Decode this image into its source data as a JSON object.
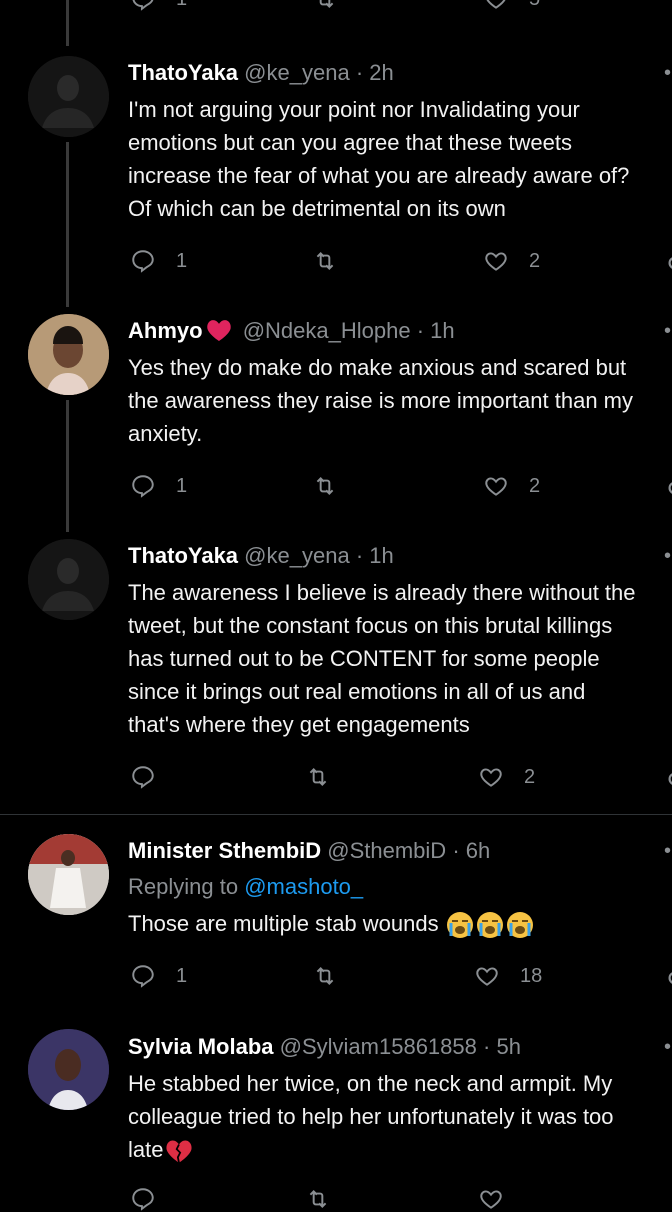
{
  "top_partial": {
    "like_count": "5",
    "reply_count": "1"
  },
  "tweets": [
    {
      "name": "ThatoYaka",
      "handle": "@ke_yena",
      "time": "2h",
      "lines": [
        "I'm not arguing your point nor Invalidating your",
        "emotions but can you agree that these tweets",
        "increase the fear of what you are already aware of?",
        "Of which can be detrimental on its own"
      ],
      "reply_count": "1",
      "like_count": "2"
    },
    {
      "name": "Ahmyo",
      "handle": "@Ndeka_Hlophe",
      "time": "1h",
      "lines": [
        "Yes they do make do make anxious and scared  but",
        "the awareness they raise is more important than my",
        "anxiety."
      ],
      "reply_count": "1",
      "like_count": "2"
    },
    {
      "name": "ThatoYaka",
      "handle": "@ke_yena",
      "time": "1h",
      "lines": [
        "The awareness I believe is already there without the",
        "tweet, but the constant focus on this brutal killings",
        "has turned out to be CONTENT for some people",
        "since it brings out real emotions in all of us and",
        "that's where they get engagements"
      ],
      "reply_count": "",
      "like_count": "2"
    },
    {
      "name": "Minister SthembiD",
      "handle": "@SthembiD",
      "time": "6h",
      "replying_label": "Replying to",
      "replying_to": "@mashoto_",
      "lines": [
        "Those are multiple stab wounds"
      ],
      "reply_count": "1",
      "like_count": "18"
    },
    {
      "name": "Sylvia Molaba",
      "handle": "@Sylviam15861858",
      "time": "5h",
      "lines": [
        "He stabbed her twice, on the neck and armpit. My",
        "colleague tried to help her unfortunately it was too",
        "late"
      ]
    }
  ],
  "separator": "·",
  "more_glyph": "•",
  "colors": {
    "background": "#000000",
    "secondary_text": "#8b8f93",
    "link": "#1d9bf0",
    "thread_line": "#3a3a3a",
    "heart_red": "#e0245e"
  }
}
